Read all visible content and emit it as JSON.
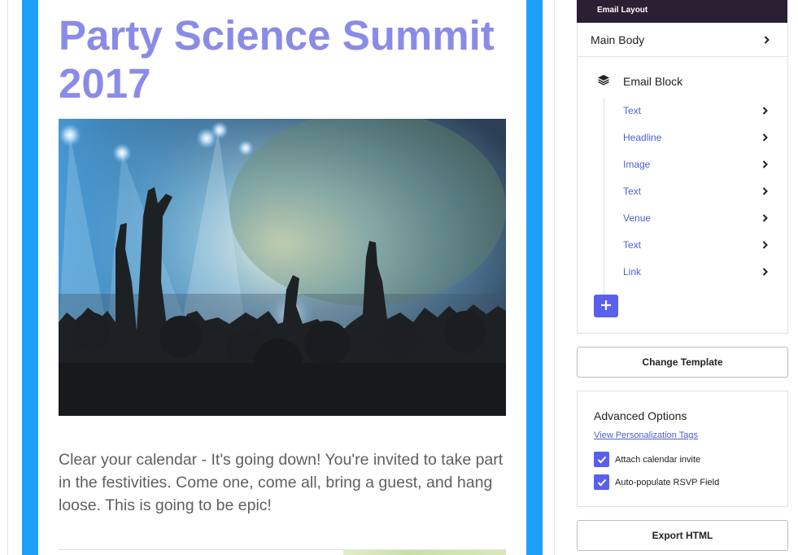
{
  "email": {
    "headline": "Party Science Summit 2017",
    "body_text": "Clear your calendar - It's going down! You're invited to take part in the festivities. Come one, come all, bring a guest, and hang loose. This is going to be epic!",
    "frame_color": "#1ea0f7",
    "headline_color": "#8a8be8"
  },
  "sidebar": {
    "header": "Email Layout",
    "main_body_label": "Main Body",
    "email_block_label": "Email Block",
    "block_items": [
      {
        "label": "Text"
      },
      {
        "label": "Headline"
      },
      {
        "label": "Image"
      },
      {
        "label": "Text"
      },
      {
        "label": "Venue"
      },
      {
        "label": "Text"
      },
      {
        "label": "Link"
      }
    ],
    "change_template_label": "Change Template",
    "advanced": {
      "title": "Advanced Options",
      "link": "View Personalization Tags",
      "options": [
        {
          "label": "Attach calendar invite",
          "checked": true
        },
        {
          "label": "Auto-populate RSVP Field",
          "checked": true
        }
      ]
    },
    "export_label": "Export HTML",
    "accent_color": "#5960ee",
    "header_color": "#2b1f33"
  },
  "icons": {
    "chevron": "chevron-right-icon",
    "layers": "layers-icon",
    "add": "plus-icon",
    "check": "check-icon"
  }
}
